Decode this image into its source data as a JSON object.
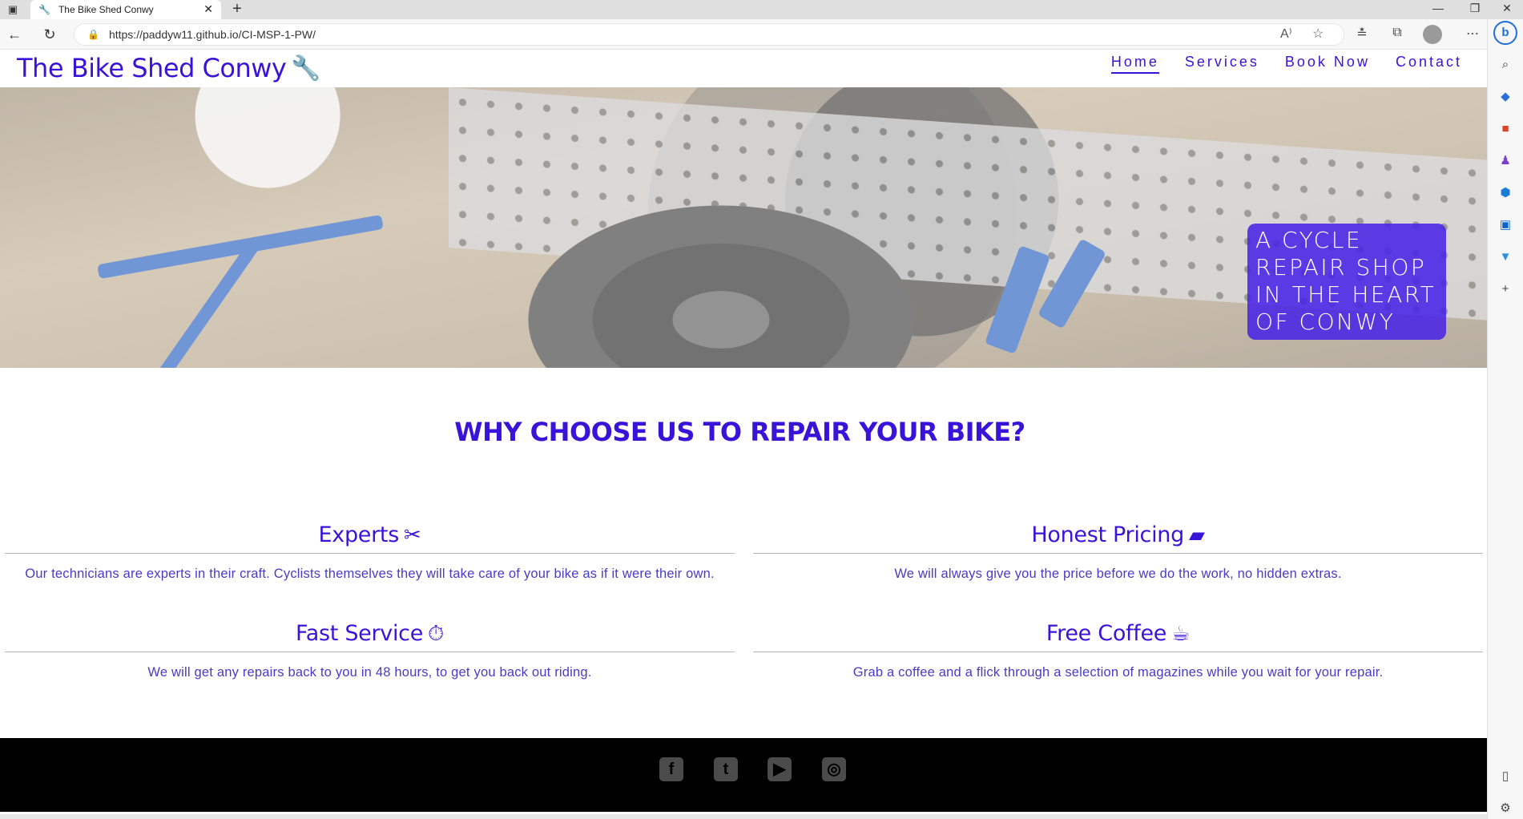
{
  "browser": {
    "tab_title": "The Bike Shed Conwy",
    "url": "https://paddyw11.github.io/CI-MSP-1-PW/",
    "new_tab_label": "+",
    "tab_close": "✕",
    "minimize": "—",
    "restore": "❐",
    "close": "✕"
  },
  "site": {
    "logo_text": "The Bike Shed Conwy",
    "nav": [
      {
        "label": "Home",
        "active": true
      },
      {
        "label": "Services",
        "active": false
      },
      {
        "label": "Book Now",
        "active": false
      },
      {
        "label": "Contact",
        "active": false
      }
    ],
    "hero_caption": "A CYCLE REPAIR SHOP IN THE HEART OF CONWY",
    "why_heading": "WHY CHOOSE US TO REPAIR YOUR BIKE?",
    "features": [
      {
        "title": "Experts",
        "icon": "tools-icon",
        "text": "Our technicians are experts in their craft. Cyclists themselves they will take care of your bike as if it were their own."
      },
      {
        "title": "Honest Pricing",
        "icon": "wallet-icon",
        "text": "We will always give you the price before we do the work, no hidden extras."
      },
      {
        "title": "Fast Service",
        "icon": "stopwatch-icon",
        "text": "We will get any repairs back to you in 48 hours, to get you back out riding."
      },
      {
        "title": "Free Coffee",
        "icon": "mug-icon",
        "text": "Grab a coffee and a flick through a selection of magazines while you wait for your repair."
      }
    ],
    "social": [
      "facebook-icon",
      "twitter-icon",
      "youtube-icon",
      "instagram-icon"
    ]
  },
  "colors": {
    "brand": "#3a13d9",
    "caption_bg": "#4924e6",
    "footer_bg": "#000000"
  }
}
